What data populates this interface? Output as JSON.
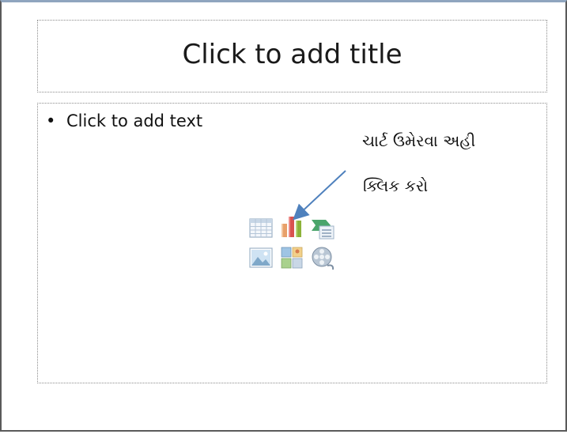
{
  "slide": {
    "title_placeholder": "Click to add title",
    "content_placeholder": "Click to add text",
    "bullet": "•"
  },
  "annotation": {
    "line1": "ચાર્ટ ઉમેરવા અહી",
    "line2": "ક્લિક કરો",
    "arrow_color": "#4f81bd"
  },
  "insert_icons": [
    "insert-table-icon",
    "insert-chart-icon",
    "insert-smartart-icon",
    "insert-picture-icon",
    "insert-clip-art-icon",
    "insert-media-clip-icon"
  ]
}
